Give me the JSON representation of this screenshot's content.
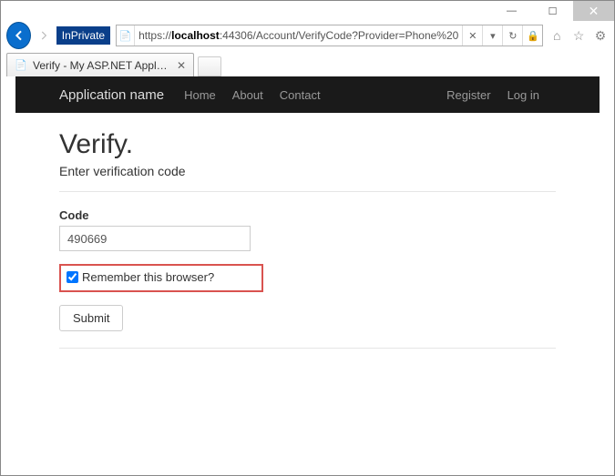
{
  "window": {
    "min": "—",
    "max": "☐",
    "close": "✕"
  },
  "browser": {
    "inprivate": "InPrivate",
    "url_prefix": "https://",
    "url_host": "localhost",
    "url_rest": ":44306/Account/VerifyCode?Provider=Phone%20",
    "tab_title": "Verify - My ASP.NET Applic..."
  },
  "nav": {
    "brand": "Application name",
    "home": "Home",
    "about": "About",
    "contact": "Contact",
    "register": "Register",
    "login": "Log in"
  },
  "page": {
    "heading": "Verify.",
    "sub": "Enter verification code",
    "code_label": "Code",
    "code_value": "490669",
    "remember": "Remember this browser?",
    "submit": "Submit"
  }
}
